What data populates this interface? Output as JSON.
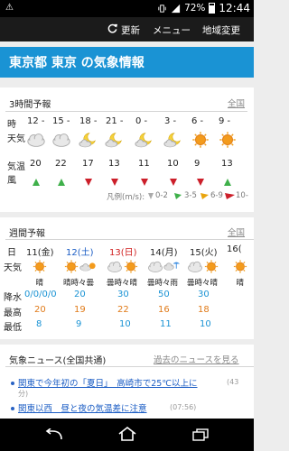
{
  "status": {
    "battery": "72%",
    "time": "12:44"
  },
  "actionbar": {
    "refresh": "更新",
    "menu": "メニュー",
    "region": "地域変更"
  },
  "header": {
    "title": "東京都 東京 の気象情報"
  },
  "three_hour": {
    "title": "3時間予報",
    "all_link": "全国",
    "row_labels": {
      "time": "時",
      "weather": "天気",
      "temp": "気温",
      "wind": "風"
    },
    "times": [
      "12 -",
      "15 -",
      "18 -",
      "21 -",
      "0 -",
      "3 -",
      "6 -",
      "9 -"
    ],
    "weather": [
      "cloudy",
      "cloudy",
      "moon-cloud",
      "moon-cloud",
      "moon-cloud",
      "moon-cloud",
      "sunny",
      "sunny"
    ],
    "temps": [
      "20",
      "22",
      "17",
      "13",
      "11",
      "10",
      "9",
      "13"
    ],
    "wind_colors": [
      "#3fb04a",
      "#3fb04a",
      "#cc1f2a",
      "#cc1f2a",
      "#cc1f2a",
      "#cc1f2a",
      "#cc1f2a",
      "#3fb04a"
    ],
    "legend": {
      "label": "凡例(m/s):",
      "r1": "0-2",
      "r2": "3-5",
      "r3": "6-9",
      "r4": "10-"
    }
  },
  "weekly": {
    "title": "週間予報",
    "all_link": "全国",
    "row_labels": {
      "day": "日",
      "weather": "天気",
      "precip": "降水",
      "high": "最高",
      "low": "最低"
    },
    "days": [
      {
        "date": "11(金)",
        "color": "#222222",
        "desc": "晴",
        "precip": "0/0/0/0",
        "high": "20",
        "low": "8"
      },
      {
        "date": "12(土)",
        "color": "#1a5cc4",
        "desc": "晴時々曇",
        "precip": "20",
        "high": "19",
        "low": "9"
      },
      {
        "date": "13(日)",
        "color": "#d02020",
        "desc": "曇時々晴",
        "precip": "30",
        "high": "22",
        "low": "10"
      },
      {
        "date": "14(月)",
        "color": "#222222",
        "desc": "曇時々雨",
        "precip": "50",
        "high": "16",
        "low": "11"
      },
      {
        "date": "15(火)",
        "color": "#222222",
        "desc": "曇時々晴",
        "precip": "30",
        "high": "18",
        "low": "10"
      },
      {
        "date": "16(",
        "color": "#222222",
        "desc": "晴",
        "precip": "",
        "high": "",
        "low": ""
      }
    ],
    "precip_color": "#1a93d4",
    "high_color": "#e07b1a",
    "low_color": "#1a93d4"
  },
  "news": {
    "title": "気象ニュース(全国共通)",
    "past_link": "過去のニュースを見る",
    "items": [
      {
        "text": "関東で今年初の「夏日」　高崎市で25℃以上に",
        "time": "(43"
      },
      {
        "text": "関東以西　昼と夜の気温差に注意",
        "time": "(07:56)"
      }
    ],
    "overflow_time": "分)"
  }
}
